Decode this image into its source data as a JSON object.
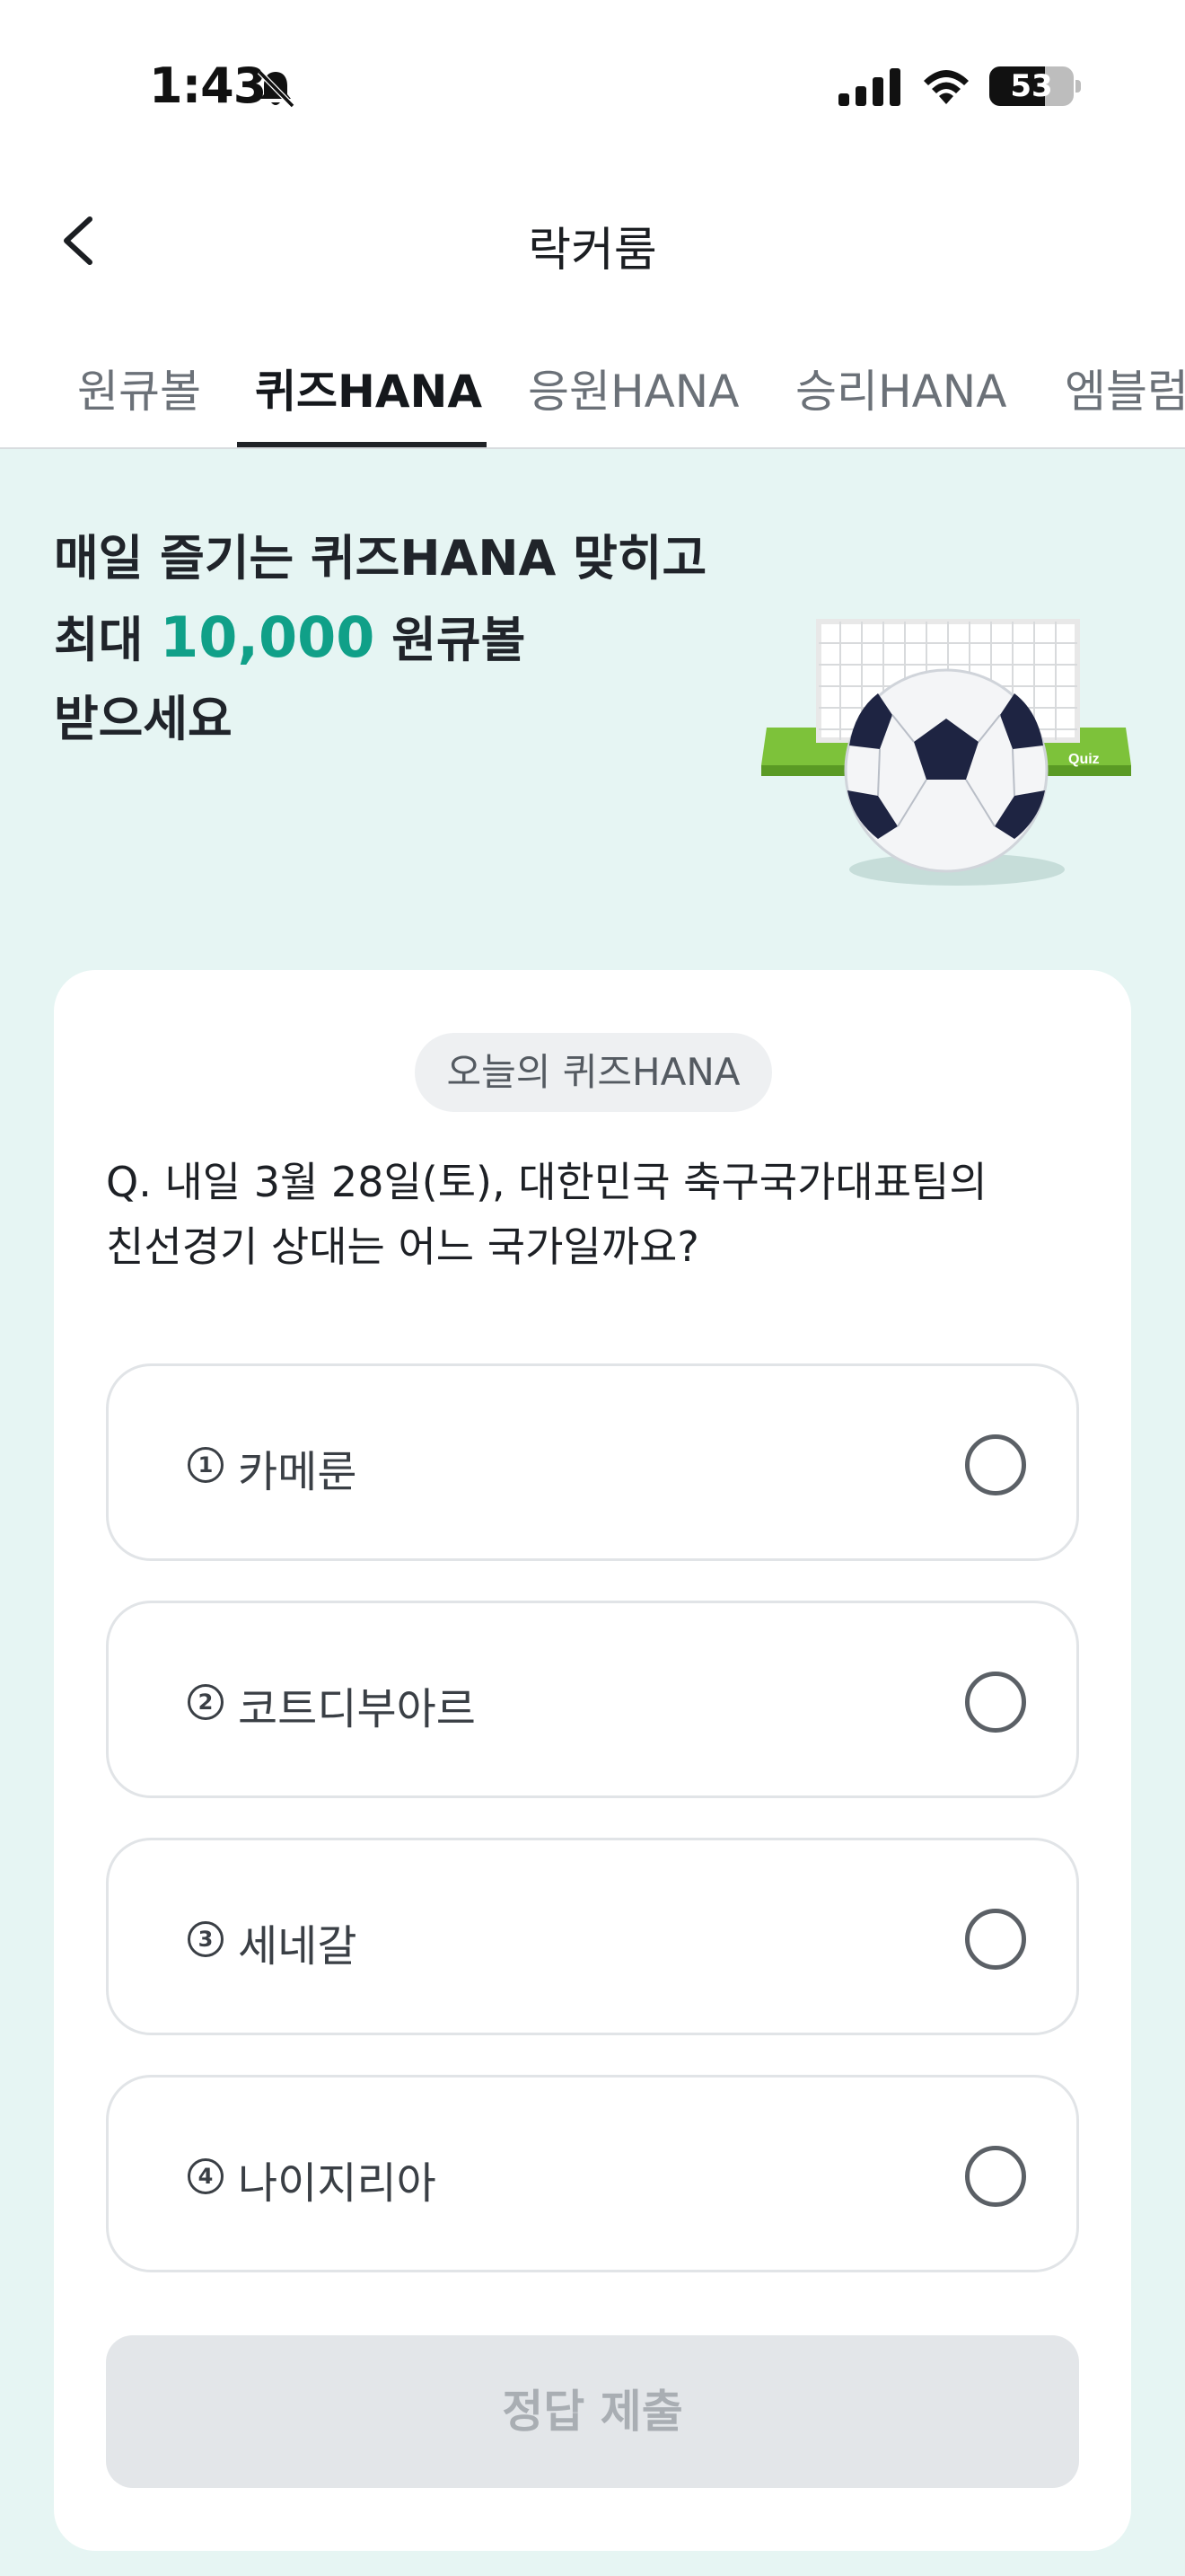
{
  "status_bar": {
    "time": "1:43",
    "battery": "53"
  },
  "header": {
    "title": "락커룸"
  },
  "tabs": [
    {
      "label": "원큐볼",
      "active": false
    },
    {
      "label": "퀴즈HANA",
      "active": true
    },
    {
      "label": "응원HANA",
      "active": false
    },
    {
      "label": "승리HANA",
      "active": false
    },
    {
      "label": "엠블럼",
      "active": false
    }
  ],
  "banner": {
    "line1": "매일 즐기는 퀴즈HANA 맞히고",
    "line2_prefix": "최대 ",
    "line2_highlight": "10,000",
    "line2_suffix": " 원큐볼",
    "line3": "받으세요",
    "art_label": "Quiz"
  },
  "quiz": {
    "badge": "오늘의 퀴즈HANA",
    "question_line1": "Q. 내일 3월 28일(토), 대한민국 축구국가대표팀의",
    "question_line2": "친선경기 상대는 어느 국가일까요?",
    "options": [
      {
        "number": "1",
        "label": "카메룬",
        "selected": false
      },
      {
        "number": "2",
        "label": "코트디부아르",
        "selected": false
      },
      {
        "number": "3",
        "label": "세네갈",
        "selected": false
      },
      {
        "number": "4",
        "label": "나이지리아",
        "selected": false
      }
    ],
    "submit_label": "정답 제출",
    "submit_enabled": false
  },
  "colors": {
    "accent": "#10a088",
    "page_background": "#e6f5f3",
    "disabled_button": "#e3e6e9"
  },
  "icons": [
    "bell-off-icon",
    "signal-icon",
    "wifi-icon",
    "battery-icon",
    "back-chevron-icon",
    "radio-icon"
  ]
}
